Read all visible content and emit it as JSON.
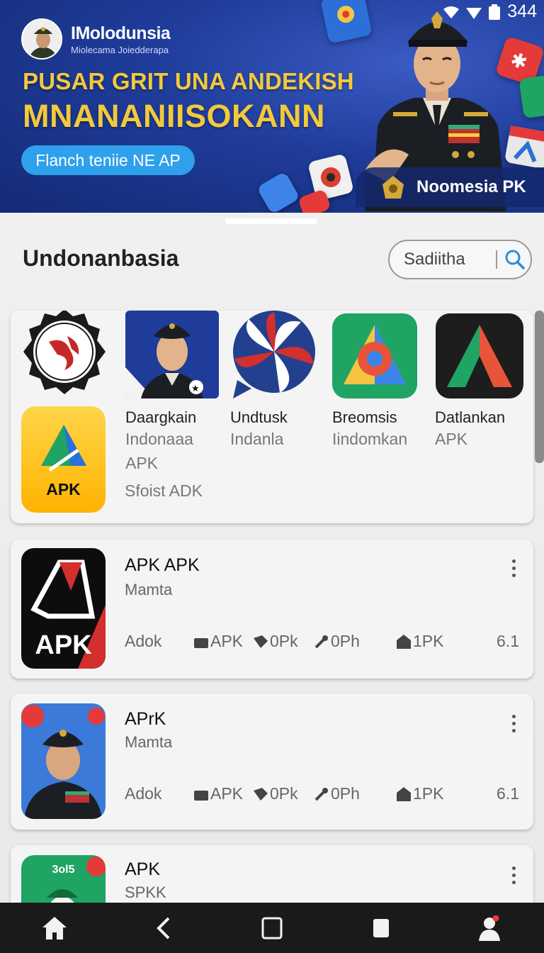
{
  "status": {
    "time": "344"
  },
  "banner": {
    "brand_title": "IMolodunsia",
    "brand_sub": "Miolecama Joiedderapa",
    "headline_line1": "PUSAR GRIT UNA ANDEKISH",
    "headline_line2": "MNANANIISOKANN",
    "button_label": "Flanch teniie NE AP",
    "tag_label": "Noomesia PK"
  },
  "section": {
    "title": "Undonanbasia",
    "search_placeholder": "Sadiitha"
  },
  "grid": [
    {
      "name": "Daargkain",
      "sub1": "Indonaaa",
      "sub2": "APK"
    },
    {
      "name": "Undtusk",
      "sub1": "Indanla",
      "sub2": ""
    },
    {
      "name": "Breomsis",
      "sub1": "Iindomkan",
      "sub2": ""
    },
    {
      "name": "Datlankan",
      "sub1": "APK",
      "sub2": ""
    }
  ],
  "grid_extra": {
    "apk_icon_label": "APK",
    "footer_text": "Sfoist ADK"
  },
  "list": [
    {
      "title": "APK APK",
      "subtitle": "Mamta",
      "icon_label": "APK",
      "stats": {
        "a": "Adok",
        "b": "APK",
        "c": "0Pk",
        "d": "0Ph",
        "e": "1PK",
        "f": "6.1"
      }
    },
    {
      "title": "APrK",
      "subtitle": "Mamta",
      "stats": {
        "a": "Adok",
        "b": "APK",
        "c": "0Pk",
        "d": "0Ph",
        "e": "1PK",
        "f": "6.1"
      }
    },
    {
      "title": "APK",
      "subtitle": "SPKK",
      "icon_label": "3ol5"
    }
  ],
  "colors": {
    "banner": "#1f3c9a",
    "accent": "#2ea0ec",
    "headline": "#f3c93c",
    "nav": "#1a1a1a"
  }
}
